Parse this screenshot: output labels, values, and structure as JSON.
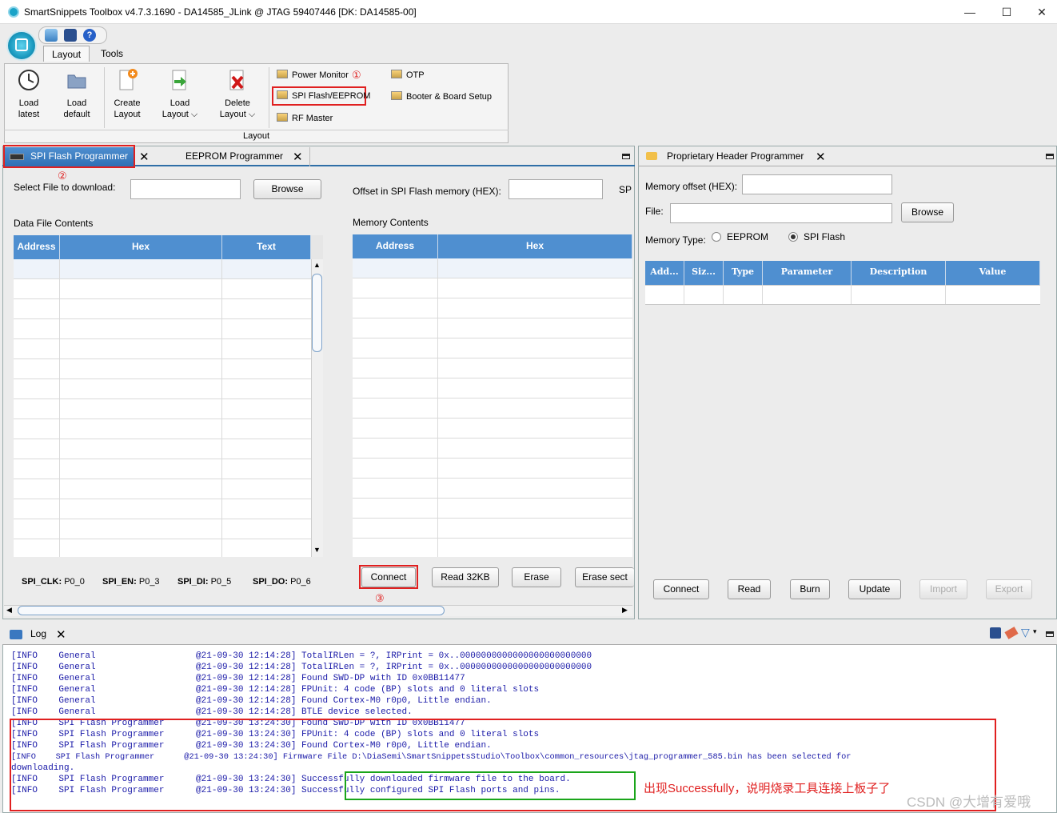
{
  "window": {
    "title": "SmartSnippets Toolbox v4.7.3.1690 - DA14585_JLink @ JTAG 59407446 [DK: DA14585-00]",
    "minimize": "—",
    "maximize": "☐",
    "close": "✕"
  },
  "ribbon": {
    "tabs": [
      "Layout",
      "Tools"
    ],
    "buttons": [
      {
        "line1": "Load",
        "line2": "latest"
      },
      {
        "line1": "Load",
        "line2": "default"
      },
      {
        "line1": "Create",
        "line2": "Layout"
      },
      {
        "line1": "Load",
        "line2": "Layout ⌵"
      },
      {
        "line1": "Delete",
        "line2": "Layout ⌵"
      }
    ],
    "small_buttons": [
      "Power Monitor",
      "SPI Flash/EEPROM",
      "RF Master",
      "OTP",
      "Booter & Board Setup"
    ],
    "group_label": "Layout"
  },
  "annotations": {
    "a1": "①",
    "a2": "②",
    "a3": "③"
  },
  "spi_panel": {
    "tabs": [
      "SPI Flash Programmer",
      "EEPROM Programmer"
    ],
    "select_file_label": "Select File to download:",
    "browse": "Browse",
    "offset_label": "Offset in SPI Flash memory (HEX):",
    "offset_cut": "SP",
    "data_file_label": "Data File Contents",
    "memory_label": "Memory Contents",
    "data_columns": [
      "Address",
      "Hex",
      "Text"
    ],
    "memory_columns": [
      "Address",
      "Hex"
    ],
    "pins": [
      {
        "name": "SPI_CLK:",
        "value": "P0_0"
      },
      {
        "name": "SPI_EN:",
        "value": "P0_3"
      },
      {
        "name": "SPI_DI:",
        "value": "P0_5"
      },
      {
        "name": "SPI_DO:",
        "value": "P0_6"
      }
    ],
    "buttons": [
      "Connect",
      "Read 32KB",
      "Erase",
      "Erase sect"
    ]
  },
  "header_panel": {
    "tab": "Proprietary Header Programmer",
    "memory_offset_label": "Memory offset (HEX):",
    "file_label": "File:",
    "browse": "Browse",
    "memory_type_label": "Memory Type:",
    "radio_eeprom": "EEPROM",
    "radio_spi": "SPI Flash",
    "columns": [
      "Add...",
      "Siz...",
      "Type",
      "Parameter",
      "Description",
      "Value"
    ],
    "buttons": [
      "Connect",
      "Read",
      "Burn",
      "Update",
      "Import",
      "Export"
    ]
  },
  "log": {
    "tab": "Log",
    "lines": [
      "[INFO    General                   @21-09-30 12:14:28] TotalIRLen = ?, IRPrint = 0x..0000000000000000000000000",
      "[INFO    General                   @21-09-30 12:14:28] TotalIRLen = ?, IRPrint = 0x..0000000000000000000000000",
      "[INFO    General                   @21-09-30 12:14:28] Found SWD-DP with ID 0x0BB11477",
      "[INFO    General                   @21-09-30 12:14:28] FPUnit: 4 code (BP) slots and 0 literal slots",
      "[INFO    General                   @21-09-30 12:14:28] Found Cortex-M0 r0p0, Little endian.",
      "[INFO    General                   @21-09-30 12:14:28] BTLE device selected.",
      "[INFO    SPI Flash Programmer      @21-09-30 13:24:30] Found SWD-DP with ID 0x0BB11477",
      "[INFO    SPI Flash Programmer      @21-09-30 13:24:30] FPUnit: 4 code (BP) slots and 0 literal slots",
      "[INFO    SPI Flash Programmer      @21-09-30 13:24:30] Found Cortex-M0 r0p0, Little endian.",
      "[INFO    SPI Flash Programmer      @21-09-30 13:24:30] Firmware File D:\\DiaSemi\\SmartSnippetsStudio\\Toolbox\\common_resources\\jtag_programmer_585.bin has been selected for",
      "downloading.",
      "[INFO    SPI Flash Programmer      @21-09-30 13:24:30] Successfully downloaded firmware file to the board.",
      "[INFO    SPI Flash Programmer      @21-09-30 13:24:30] Successfully configured SPI Flash ports and pins."
    ],
    "annotation": "出现Successfully，说明烧录工具连接上板子了"
  },
  "watermark": "CSDN @大增有爱哦",
  "colors": {
    "accent": "#4f8fd0",
    "highlight": "#e02020",
    "success_box": "#1aa51a",
    "log_text": "#1a1aa8"
  }
}
